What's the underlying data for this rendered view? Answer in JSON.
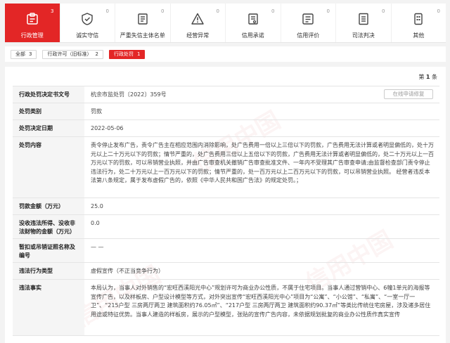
{
  "nav": {
    "items": [
      {
        "label": "行政管理",
        "count": "3",
        "icon": "admin-icon"
      },
      {
        "label": "诚实守信",
        "count": "0",
        "icon": "honest-icon"
      },
      {
        "label": "严重失信主体名单",
        "count": "0",
        "icon": "blacklist-icon"
      },
      {
        "label": "经营异常",
        "count": "0",
        "icon": "warning-icon"
      },
      {
        "label": "信用承诺",
        "count": "0",
        "icon": "commitment-icon"
      },
      {
        "label": "信用评价",
        "count": "0",
        "icon": "evaluation-icon"
      },
      {
        "label": "司法判决",
        "count": "0",
        "icon": "judgment-icon"
      },
      {
        "label": "其他",
        "count": "0",
        "icon": "other-icon"
      }
    ]
  },
  "filters": [
    {
      "label": "全部",
      "count": "3"
    },
    {
      "label": "行政许可（旧标准）",
      "count": "2"
    },
    {
      "label": "行政处罚",
      "count": "1"
    }
  ],
  "pager": {
    "prefix": "第",
    "page": "1",
    "suffix": "条"
  },
  "repair_button": "在线申请修复",
  "rows": [
    {
      "key": "行政处罚决定书文号",
      "value": "杭余市监处罚〔2022〕359号"
    },
    {
      "key": "处罚类别",
      "value": "罚款"
    },
    {
      "key": "处罚决定日期",
      "value": "2022-05-06"
    },
    {
      "key": "处罚内容",
      "value": "责令停止发布广告，责令广告主在相应范围内消除影响，处广告费用一倍以上三倍以下的罚款，广告费用无法计算或者明显偏低的，处十万元以上二十万元以下的罚款；情节严重的，处广告费用三倍以上五倍以下的罚款，广告费用无法计算或者明显偏低的，处二十万元以上一百万元以下的罚款，可以吊销营业执照，并由广告审查机关撤销广告审查批准文件、一年内不受理其广告审查申请;由监督检查部门责令停止违法行为，处二十万元以上一百万元以下的罚款；情节严重的，处一百万元以上二百万元以下的罚款，可以吊销营业执照。 经营者违反本法第八条规定，属于发布虚假广告的，依照《中华人民共和国广告法》的规定处罚。；"
    },
    {
      "key": "罚款金额（万元）",
      "value": "25.0"
    },
    {
      "key": "没收违法所得、没收非法财物的金额（万元）",
      "value": "0.0"
    },
    {
      "key": "暂扣或吊销证照名称及编号",
      "value": "— —"
    },
    {
      "key": "违法行为类型",
      "value": "虚假宣传（不正当竞争行为）"
    },
    {
      "key": "违法事实",
      "value": "本局认为，当事人对外销售的“宏旺西溪阳光中心”规划许可为商业办公性质，不属于住宅项目。当事人通过营销中心、6幢1单元的海报等宣传广告，以及样板房、户型设计模型等方式，对外突出宣传“宏旺西溪阳光中心”项目为“公寓”、“小公馆”、“私寓”、“一室一厅一卫”、“215户型 三房两厅两卫 建筑面积约76.05㎡”、“217户型 三房两厅两卫 建筑面积约90.37㎡”等类比传统住宅房屋，涉及诸多居住用途或特征优势。当事人建造的样板房，展示的户型模型，张贴的宣传广告内容，未依据规划批复的商业办公性质作真实宣传"
    }
  ],
  "colors": {
    "accent": "#e32626"
  }
}
